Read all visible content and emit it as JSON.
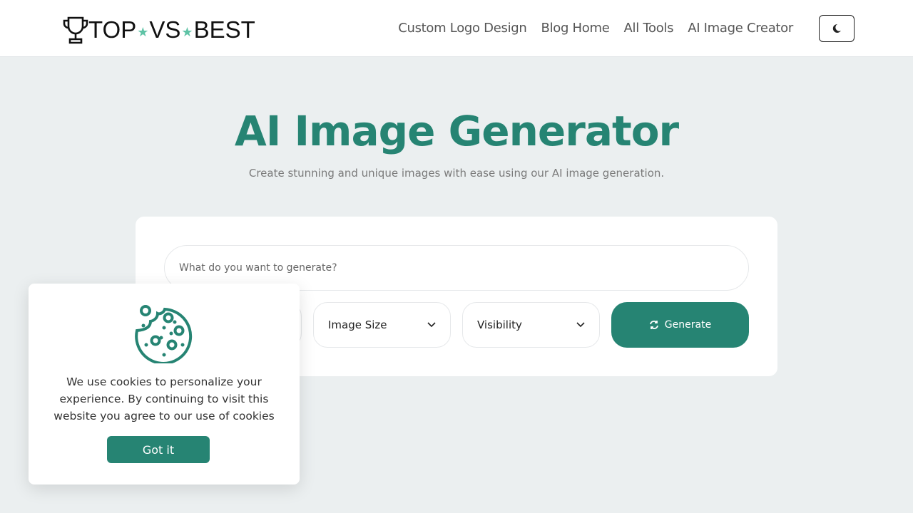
{
  "header": {
    "logo": {
      "part1": "TOP",
      "part2": "VS",
      "part3": "BEST"
    },
    "nav": [
      "Custom Logo Design",
      "Blog Home",
      "All Tools",
      "AI Image Creator"
    ],
    "theme_toggle_icon": "moon-icon"
  },
  "hero": {
    "title": "AI Image Generator",
    "subtitle": "Create stunning and unique images with ease using our AI image generation."
  },
  "form": {
    "prompt_placeholder": "What do you want to generate?",
    "image_size": "Image Size",
    "visibility": "Visibility",
    "generate": "Generate"
  },
  "cookie": {
    "text": "We use cookies to personalize your experience. By continuing to visit this website you agree to our use of cookies",
    "button": "Got it"
  },
  "colors": {
    "accent": "#268473",
    "star": "#5fc3a6"
  }
}
